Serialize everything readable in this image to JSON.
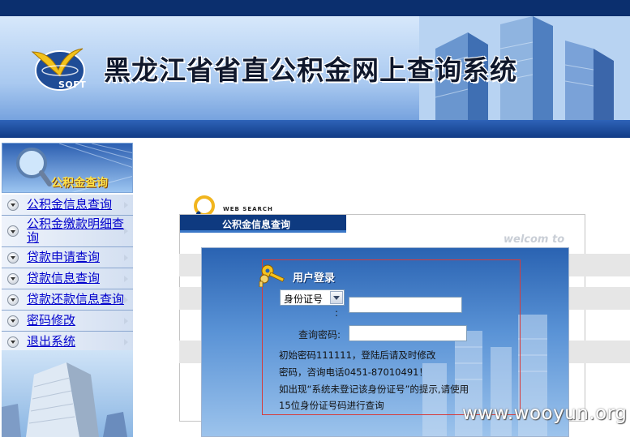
{
  "header": {
    "title": "黑龙江省省直公积金网上查询系统",
    "logo_text": "SOFT"
  },
  "sidebar": {
    "header_label": "公积金查询",
    "items": [
      {
        "label": "公积金信息查询"
      },
      {
        "label": "公积金缴款明细查询"
      },
      {
        "label": "贷款申请查询"
      },
      {
        "label": "贷款信息查询"
      },
      {
        "label": "贷款还款信息查询"
      },
      {
        "label": "密码修改"
      },
      {
        "label": "退出系统"
      }
    ]
  },
  "main": {
    "web_search_label": "WEB SEARCH",
    "section_title": "公积金信息查询",
    "welcome_text": "welcom to"
  },
  "login": {
    "title": "用户登录",
    "id_type": {
      "selected": "身份证号"
    },
    "id_colon": ":",
    "id_value": "",
    "password_label": "查询密码:",
    "password_value": "",
    "notes": [
      "初始密码111111，登陆后请及时修改",
      "密码，咨询电话0451-87010491！",
      "如出现“系统未登记该身份证号”的提示,请使用",
      "15位身份证号码进行查询"
    ]
  },
  "watermark": "www.wooyun.org",
  "colors": {
    "header_dark": "#0b2f6e",
    "tab_navy": "#0e3a80",
    "link_blue": "#0000cc",
    "login_border": "#d63c3c"
  }
}
